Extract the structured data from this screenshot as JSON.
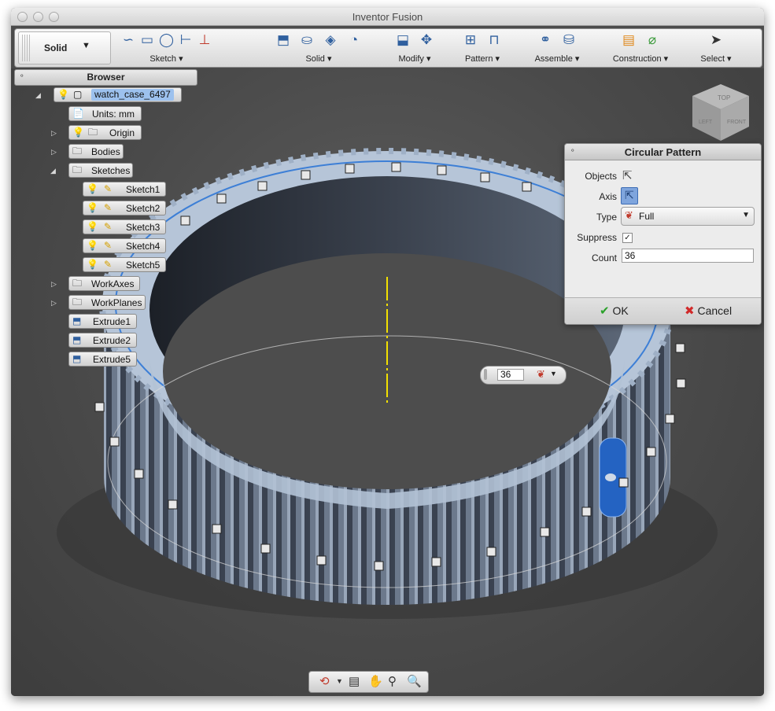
{
  "window": {
    "title": "Inventor Fusion"
  },
  "ribbon": {
    "workspace": "Solid",
    "groups": [
      {
        "id": "sketch",
        "label": "Sketch"
      },
      {
        "id": "solid",
        "label": "Solid"
      },
      {
        "id": "modify",
        "label": "Modify"
      },
      {
        "id": "pattern",
        "label": "Pattern"
      },
      {
        "id": "assemble",
        "label": "Assemble"
      },
      {
        "id": "construction",
        "label": "Construction"
      },
      {
        "id": "select",
        "label": "Select"
      }
    ]
  },
  "browser": {
    "title": "Browser",
    "root": "watch_case_6497",
    "units": "Units: mm",
    "origin": "Origin",
    "bodies": "Bodies",
    "sketches": "Sketches",
    "sketch_items": [
      "Sketch1",
      "Sketch2",
      "Sketch3",
      "Sketch4",
      "Sketch5"
    ],
    "workaxes": "WorkAxes",
    "workplanes": "WorkPlanes",
    "features": [
      "Extrude1",
      "Extrude2",
      "Extrude5"
    ]
  },
  "viewcube": {
    "top": "TOP",
    "left": "LEFT",
    "front": "FRONT"
  },
  "dialog": {
    "title": "Circular Pattern",
    "objects_label": "Objects",
    "axis_label": "Axis",
    "type_label": "Type",
    "type_value": "Full",
    "suppress_label": "Suppress",
    "suppress_checked": true,
    "count_label": "Count",
    "count_value": "36",
    "ok": "OK",
    "cancel": "Cancel"
  },
  "inline_count": "36",
  "colors": {
    "accent": "#2f5f9e",
    "selection": "#9cc1ee",
    "viewport": "#4b4b4b",
    "model": "#b6c5d8",
    "ok": "#2aa12a",
    "cancel": "#d12a2a"
  }
}
